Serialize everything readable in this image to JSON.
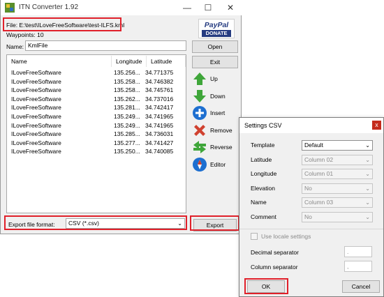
{
  "window": {
    "title": "ITN Converter 1.92",
    "minimize": "—",
    "maximize": "☐",
    "close": "✕"
  },
  "file_line": "File: E:\\test\\ILoveFreeSoftware\\test-ILFS.kml",
  "waypoints_label": "Waypoints: 10",
  "name": {
    "label": "Name:",
    "value": "KmlFile"
  },
  "paypal": {
    "brand": "PayPal",
    "action": "DONATE"
  },
  "buttons": {
    "open": "Open",
    "exit": "Exit",
    "export": "Export"
  },
  "list": {
    "columns": [
      "Name",
      "Longitude",
      "Latitude"
    ],
    "rows": [
      [
        "ILoveFreeSoftware",
        "135.256...",
        "34.771375"
      ],
      [
        "ILoveFreeSoftware",
        "135.258...",
        "34.746382"
      ],
      [
        "ILoveFreeSoftware",
        "135.258...",
        "34.745761"
      ],
      [
        "ILoveFreeSoftware",
        "135.262...",
        "34.737016"
      ],
      [
        "ILoveFreeSoftware",
        "135.281...",
        "34.742417"
      ],
      [
        "ILoveFreeSoftware",
        "135.249...",
        "34.741965"
      ],
      [
        "ILoveFreeSoftware",
        "135.249...",
        "34.741965"
      ],
      [
        "ILoveFreeSoftware",
        "135.285...",
        "34.736031"
      ],
      [
        "ILoveFreeSoftware",
        "135.277...",
        "34.741427"
      ],
      [
        "ILoveFreeSoftware",
        "135.250...",
        "34.740085"
      ]
    ]
  },
  "side_actions": [
    {
      "label": "Up",
      "icon": "arrow-up-icon",
      "color": "#3fa63a"
    },
    {
      "label": "Down",
      "icon": "arrow-down-icon",
      "color": "#3fa63a"
    },
    {
      "label": "Insert",
      "icon": "plus-icon",
      "color": "#1e6fd0"
    },
    {
      "label": "Remove",
      "icon": "x-icon",
      "color": "#d0412f"
    },
    {
      "label": "Reverse",
      "icon": "reverse-arrows-icon",
      "color": "#3fa63a"
    },
    {
      "label": "Editor",
      "icon": "compass-icon",
      "color": "#1e6fd0"
    }
  ],
  "export_format": {
    "label": "Export file format:",
    "value": "CSV (*.csv)"
  },
  "settings": {
    "title": "Settings CSV",
    "close": "x",
    "fields": [
      {
        "label": "Template",
        "value": "Default",
        "enabled": true
      },
      {
        "label": "Latitude",
        "value": "Column 02",
        "enabled": false
      },
      {
        "label": "Longitude",
        "value": "Column 01",
        "enabled": false
      },
      {
        "label": "Elevation",
        "value": "No",
        "enabled": false
      },
      {
        "label": "Name",
        "value": "Column 03",
        "enabled": false
      },
      {
        "label": "Comment",
        "value": "No",
        "enabled": false
      }
    ],
    "use_locale": "Use locale settings",
    "decimal_separator": {
      "label": "Decimal separator",
      "value": "."
    },
    "column_separator": {
      "label": "Column separator",
      "value": ","
    },
    "ok": "OK",
    "cancel": "Cancel"
  },
  "colors": {
    "highlight": "#e0202a",
    "paypal_blue": "#253b80",
    "paypal_light": "#179bd7"
  }
}
